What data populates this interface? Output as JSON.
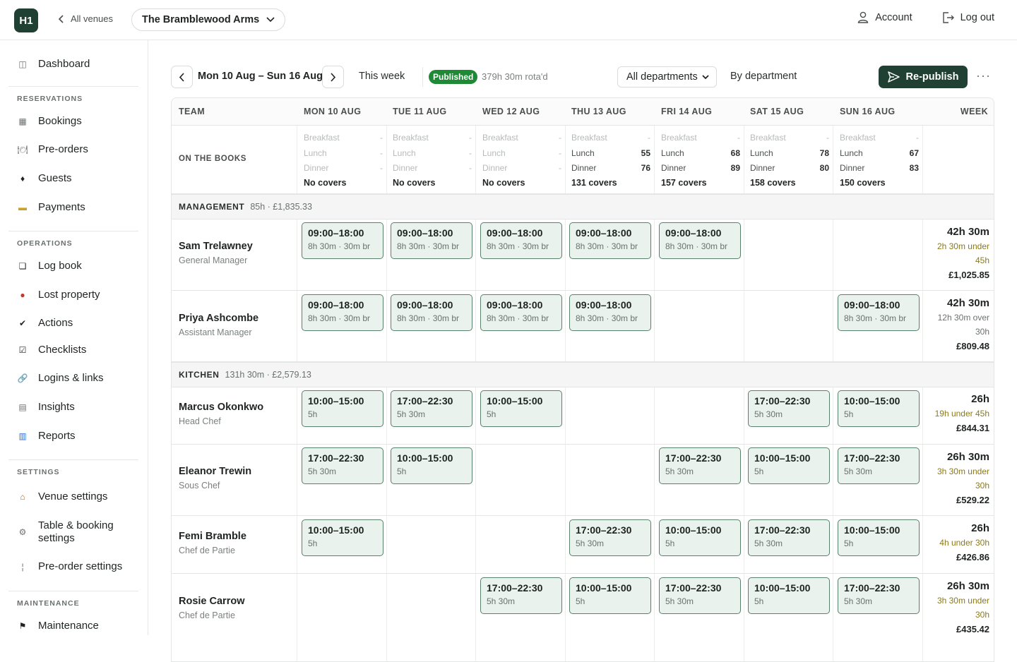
{
  "topbar": {
    "logo": "H1",
    "back_label": "All venues",
    "venue": "The Bramblewood Arms",
    "account": "Account",
    "logout": "Log out"
  },
  "sidebar": {
    "dashboard": "Dashboard",
    "sections": {
      "reservations": "RESERVATIONS",
      "operations": "OPERATIONS",
      "settings": "SETTINGS",
      "maintenance": "MAINTENANCE"
    },
    "items": {
      "bookings": "Bookings",
      "preorders": "Pre-orders",
      "guests": "Guests",
      "payments": "Payments",
      "logbook": "Log book",
      "lost_property": "Lost property",
      "actions": "Actions",
      "checklists": "Checklists",
      "logins": "Logins & links",
      "insights": "Insights",
      "reports": "Reports",
      "venue_settings": "Venue settings",
      "table_booking_1": "Table & booking",
      "table_booking_2": "settings",
      "preorder_settings": "Pre-order settings",
      "maintenance": "Maintenance"
    }
  },
  "toolbar": {
    "range": "Mon 10 Aug – Sun 16 Aug",
    "this_week": "This week",
    "status": "Published",
    "summary": "379h 30m rota'd",
    "department": "All departments",
    "by_department": "By department",
    "republish": "Re-publish"
  },
  "grid": {
    "headers": {
      "team": "TEAM",
      "mon": "MON 10 AUG",
      "tue": "TUE 11 AUG",
      "wed": "WED 12 AUG",
      "thu": "THU 13 AUG",
      "fri": "FRI 14 AUG",
      "sat": "SAT 15 AUG",
      "sun": "SUN 16 AUG",
      "week": "WEEK"
    },
    "books": {
      "label": "ON THE BOOKS",
      "breakfast": "Breakfast",
      "lunch": "Lunch",
      "dinner": "Dinner",
      "dash": "-",
      "mon": {
        "total": "No covers"
      },
      "tue": {
        "total": "No covers"
      },
      "wed": {
        "total": "No covers"
      },
      "thu": {
        "lunch": "55",
        "dinner": "76",
        "total": "131 covers"
      },
      "fri": {
        "lunch": "68",
        "dinner": "89",
        "total": "157 covers"
      },
      "sat": {
        "lunch": "78",
        "dinner": "80",
        "total": "158 covers"
      },
      "sun": {
        "lunch": "67",
        "dinner": "83",
        "total": "150 covers"
      }
    },
    "management": {
      "name": "MANAGEMENT",
      "meta": "85h · £1,835.33"
    },
    "kitchen": {
      "name": "KITCHEN",
      "meta": "131h 30m · £2,579.13"
    },
    "shift_types": {
      "mgmt_time": "09:00–18:00",
      "mgmt_meta": "8h 30m · 30m br",
      "lunch_time": "10:00–15:00",
      "lunch_meta": "5h",
      "dinner_time": "17:00–22:30",
      "dinner_meta": "5h 30m"
    },
    "staff": {
      "sam": {
        "name": "Sam Trelawney",
        "role": "General Manager",
        "hours": "42h 30m",
        "note1": "2h 30m under",
        "note2": "45h",
        "cost": "£1,025.85"
      },
      "priya": {
        "name": "Priya Ashcombe",
        "role": "Assistant Manager",
        "hours": "42h 30m",
        "note1": "12h 30m over",
        "note2": "30h",
        "cost": "£809.48"
      },
      "marcus": {
        "name": "Marcus Okonkwo",
        "role": "Head Chef",
        "hours": "26h",
        "note1": "19h under 45h",
        "cost": "£844.31"
      },
      "eleanor": {
        "name": "Eleanor Trewin",
        "role": "Sous Chef",
        "hours": "26h 30m",
        "note1": "3h 30m under",
        "note2": "30h",
        "cost": "£529.22"
      },
      "femi": {
        "name": "Femi Bramble",
        "role": "Chef de Partie",
        "hours": "26h",
        "note1": "4h under 30h",
        "cost": "£426.86"
      },
      "rosie": {
        "name": "Rosie Carrow",
        "role": "Chef de Partie",
        "hours": "26h 30m",
        "note1": "3h 30m under",
        "note2": "30h",
        "cost": "£435.42"
      }
    }
  }
}
